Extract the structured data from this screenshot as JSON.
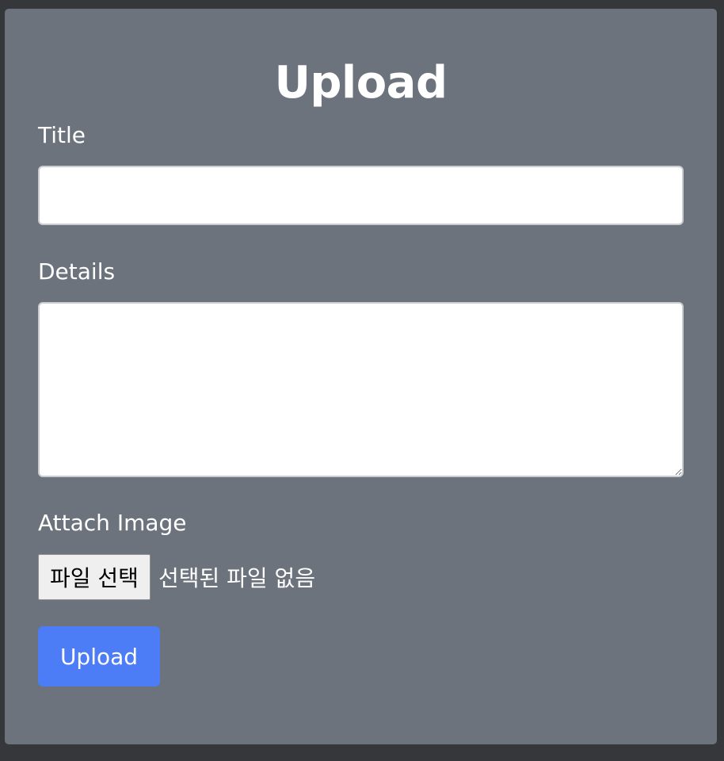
{
  "form": {
    "title": "Upload",
    "fields": {
      "title_label": "Title",
      "title_value": "",
      "title_placeholder": "",
      "details_label": "Details",
      "details_value": "",
      "details_placeholder": "",
      "image_label": "Attach Image",
      "file_button_label": "파일 선택",
      "file_status": "선택된 파일 없음"
    },
    "submit_label": "Upload"
  },
  "colors": {
    "background": "#35373b",
    "card": "#6c737c",
    "accent": "#4d7cf7",
    "text": "#ffffff"
  }
}
